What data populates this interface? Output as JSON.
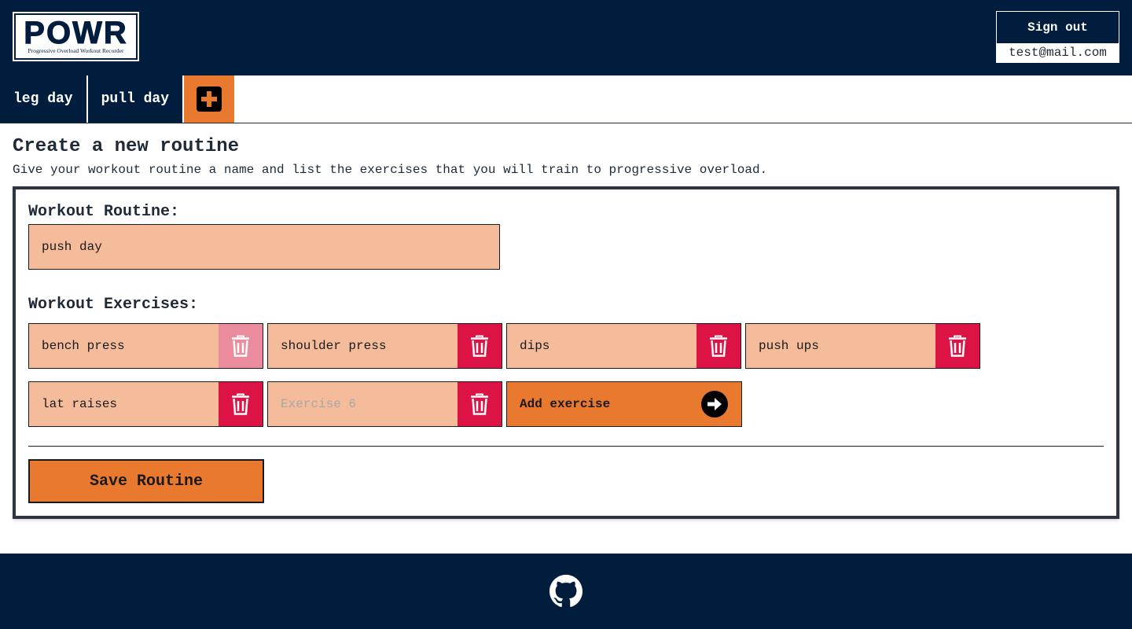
{
  "header": {
    "logo": {
      "title": "POWR",
      "subtitle": "Progressive Overload Workout Recorder"
    },
    "sign_out_label": "Sign out",
    "user_email": "test@mail.com"
  },
  "tabs": [
    {
      "label": "leg day"
    },
    {
      "label": "pull day"
    }
  ],
  "add_tab_icon": "plus-square-icon",
  "page": {
    "title": "Create a new routine",
    "description": "Give your workout routine a name and list the exercises that you will train to progressive overload."
  },
  "form": {
    "routine_label": "Workout Routine:",
    "routine_value": "push day",
    "exercises_label": "Workout Exercises:",
    "exercises": [
      {
        "value": "bench press",
        "placeholder": "",
        "delete_disabled": true
      },
      {
        "value": "shoulder press",
        "placeholder": "",
        "delete_disabled": false
      },
      {
        "value": "dips",
        "placeholder": "",
        "delete_disabled": false
      },
      {
        "value": "push ups",
        "placeholder": "",
        "delete_disabled": false
      },
      {
        "value": "lat raises",
        "placeholder": "",
        "delete_disabled": false
      },
      {
        "value": "",
        "placeholder": "Exercise 6",
        "delete_disabled": false
      }
    ],
    "add_exercise_label": "Add exercise",
    "save_label": "Save Routine"
  },
  "footer": {
    "icon": "github-icon"
  },
  "colors": {
    "navy": "#001d3d",
    "orange": "#e8792e",
    "input_peach": "#f4bc9b",
    "delete_red": "#dc1446",
    "delete_disabled": "#ea8c9d"
  }
}
